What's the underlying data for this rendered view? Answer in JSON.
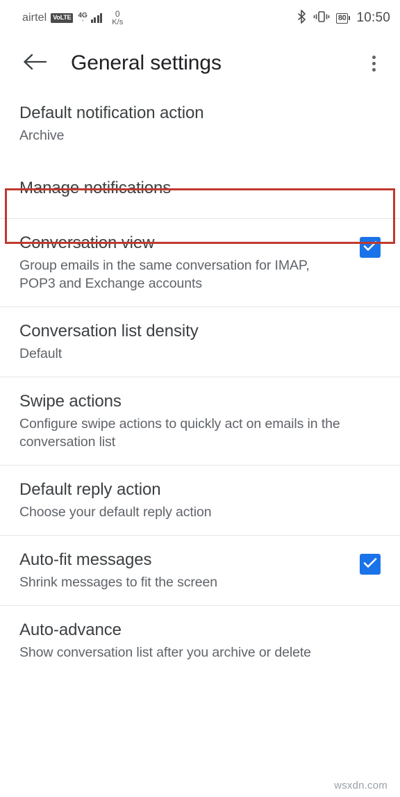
{
  "status_bar": {
    "carrier": "airtel",
    "volte_badge": "VoLTE",
    "network_type": "4G",
    "network_type_sup": "+",
    "net_speed_value": "0",
    "net_speed_unit": "K/s",
    "bluetooth_icon": "bluetooth-icon",
    "vibrate_icon": "vibrate-icon",
    "battery_level": "80",
    "time": "10:50"
  },
  "app_bar": {
    "back_icon": "back-arrow-icon",
    "title": "General settings",
    "overflow_icon": "overflow-menu-icon"
  },
  "settings": {
    "items": [
      {
        "title": "Default notification action",
        "subtitle": "Archive",
        "checkbox": false,
        "highlighted": false
      },
      {
        "title": "Manage notifications",
        "subtitle": "",
        "checkbox": false,
        "highlighted": true
      },
      {
        "title": "Conversation view",
        "subtitle": "Group emails in the same conversation for IMAP, POP3 and Exchange accounts",
        "checkbox": true,
        "checked": true,
        "highlighted": false
      },
      {
        "title": "Conversation list density",
        "subtitle": "Default",
        "checkbox": false,
        "highlighted": false
      },
      {
        "title": "Swipe actions",
        "subtitle": "Configure swipe actions to quickly act on emails in the conversation list",
        "checkbox": false,
        "highlighted": false
      },
      {
        "title": "Default reply action",
        "subtitle": "Choose your default reply action",
        "checkbox": false,
        "highlighted": false
      },
      {
        "title": "Auto-fit messages",
        "subtitle": "Shrink messages to fit the screen",
        "checkbox": true,
        "checked": true,
        "highlighted": false
      },
      {
        "title": "Auto-advance",
        "subtitle": "Show conversation list after you archive or delete",
        "checkbox": false,
        "highlighted": false
      }
    ]
  },
  "watermark": "wsxdn.com",
  "colors": {
    "accent_checkbox": "#1a73e8",
    "annotation_red": "#c0392f",
    "title_text": "#202124",
    "body_text": "#3c4043",
    "secondary_text": "#5f6368",
    "divider": "#e4e6e8"
  }
}
